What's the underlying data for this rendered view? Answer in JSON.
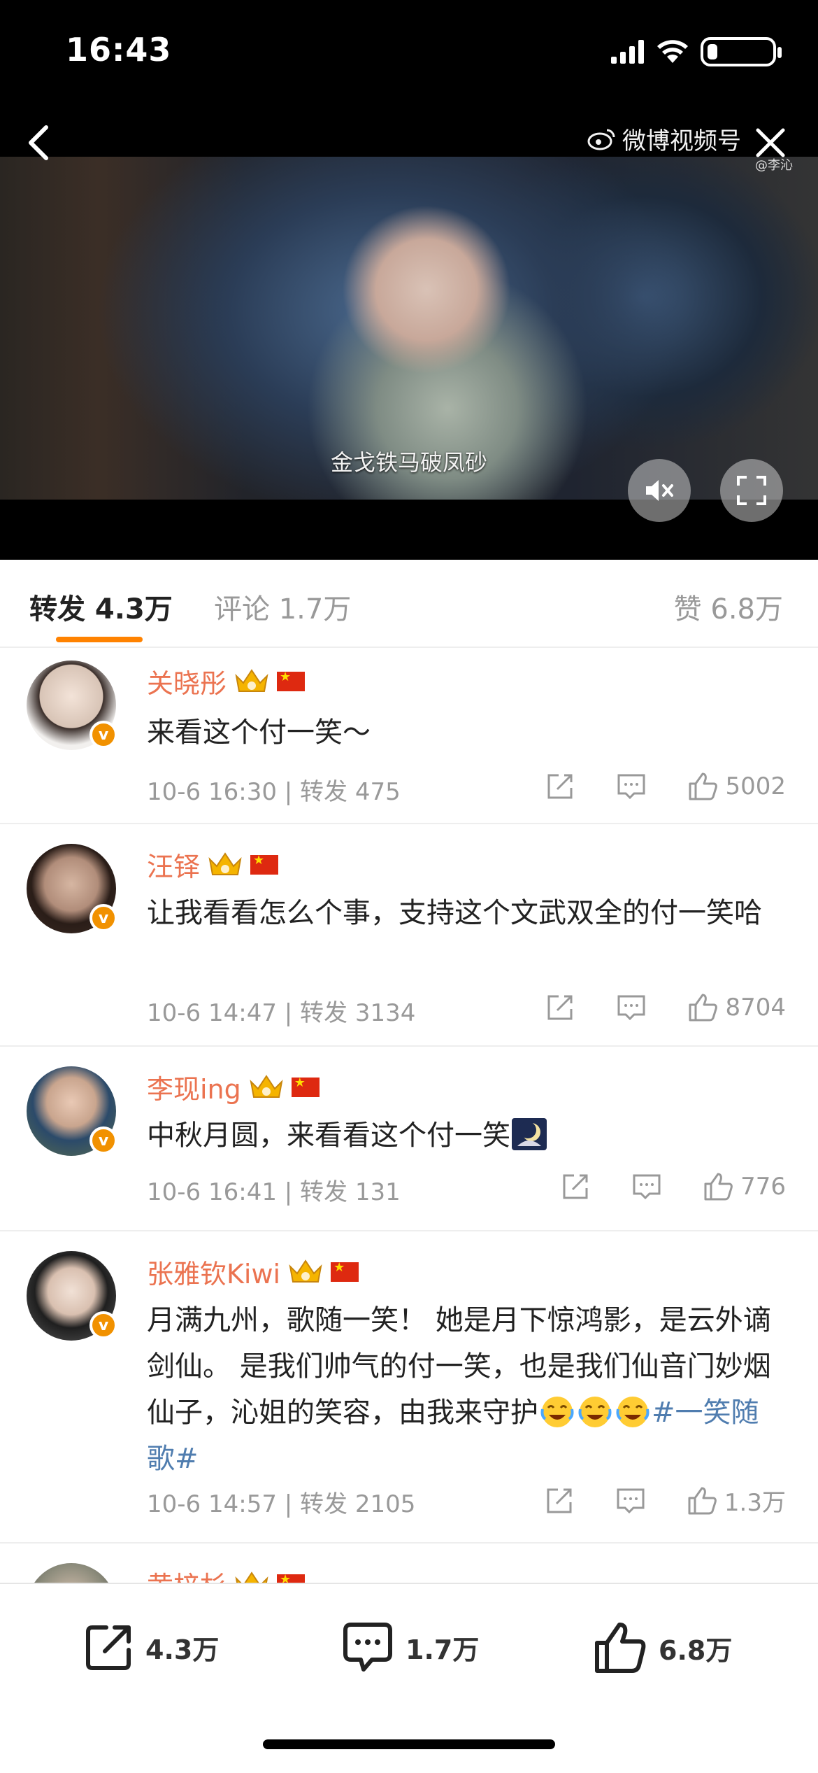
{
  "status_bar": {
    "time": "16:43",
    "battery_level": 0.15
  },
  "video": {
    "watermark": "微博视频号",
    "watermark_sub": "@李沁",
    "subtitle": "金戈铁马破凤砂"
  },
  "tabs": [
    {
      "label": "转发 4.3万",
      "active": true
    },
    {
      "label": "评论 1.7万",
      "active": false
    },
    {
      "label": "赞 6.8万",
      "active": false
    }
  ],
  "comments": [
    {
      "name": "关晓彤",
      "text": "来看这个付一笑～",
      "meta": "10-6 16:30 | 转发 475",
      "likes": "5002",
      "verified_badge": "v"
    },
    {
      "name": "汪铎",
      "text": "让我看看怎么个事，支持这个文武双全的付一笑哈",
      "meta": "10-6 14:47 | 转发 3134",
      "likes": "8704",
      "verified_badge": "v"
    },
    {
      "name": "李现ing",
      "text": "中秋月圆，来看看这个付一笑",
      "meta": "10-6 16:41 | 转发 131",
      "likes": "776",
      "verified_badge": "v"
    },
    {
      "name": "张雅钦Kiwi",
      "text": "月满九州，歌随一笑！ 她是月下惊鸿影，是云外谪剑仙。 是我们帅气的付一笑，也是我们仙音门妙烟仙子，沁姐的笑容，由我来守护",
      "topic": "#一笑随歌#",
      "meta": "10-6 14:57 | 转发 2105",
      "likes": "1.3万",
      "verified_badge": "v"
    },
    {
      "name": "黄梓杉"
    }
  ],
  "bottom_bar": {
    "repost": "4.3万",
    "comment": "1.7万",
    "like": "6.8万"
  },
  "colors": {
    "accent": "#ff8200",
    "name": "#eb7350",
    "topic": "#507daf",
    "muted": "#999999"
  }
}
